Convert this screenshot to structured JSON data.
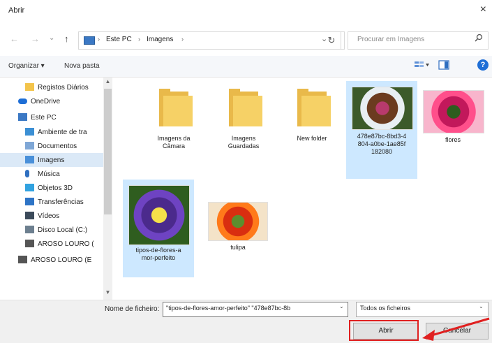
{
  "window": {
    "title": "Abrir",
    "close_glyph": "×"
  },
  "nav": {
    "back_glyph": "←",
    "forward_glyph": "→",
    "up_glyph": "↑",
    "breadcrumb": [
      "Este PC",
      "Imagens"
    ],
    "sep": "›",
    "dropdown_glyph": "⌄",
    "refresh_glyph": "↻",
    "search_placeholder": "Procurar em Imagens",
    "search_icon": "search-icon"
  },
  "toolbar": {
    "organize": "Organizar ▾",
    "new_folder": "Nova pasta"
  },
  "sidebar": {
    "items": [
      {
        "label": "Registos Diários",
        "icon": "folder-icon",
        "color": "#f3c44b"
      },
      {
        "label": "OneDrive",
        "icon": "cloud-icon",
        "color": "#1e6ed6"
      },
      {
        "label": "Este PC",
        "icon": "computer-icon",
        "color": "#3b78c4"
      },
      {
        "label": "Ambiente de tra",
        "icon": "desktop-icon",
        "color": "#3b8fd4"
      },
      {
        "label": "Documentos",
        "icon": "documents-icon",
        "color": "#7fa7d6"
      },
      {
        "label": "Imagens",
        "icon": "pictures-icon",
        "color": "#4a90d9",
        "selected": true
      },
      {
        "label": "Música",
        "icon": "music-icon",
        "color": "#2f6fc0"
      },
      {
        "label": "Objetos 3D",
        "icon": "cube-icon",
        "color": "#31a2e0"
      },
      {
        "label": "Transferências",
        "icon": "download-icon",
        "color": "#2d74c6"
      },
      {
        "label": "Vídeos",
        "icon": "video-icon",
        "color": "#3b4a5a"
      },
      {
        "label": "Disco Local (C:)",
        "icon": "drive-icon",
        "color": "#6d7f8f"
      },
      {
        "label": "AROSO LOURO (",
        "icon": "drive-icon",
        "color": "#555555"
      },
      {
        "label": "AROSO LOURO (E",
        "icon": "drive-icon",
        "color": "#555555"
      }
    ],
    "scroll_up": "▲",
    "scroll_down": "▼"
  },
  "files": [
    {
      "type": "folder",
      "label": "Imagens da Câmara"
    },
    {
      "type": "folder",
      "label": "Imagens Guardadas"
    },
    {
      "type": "folder",
      "label": "New folder"
    },
    {
      "type": "image",
      "label": "478e87bc-8bd3-4804-a0be-1ae85f182080",
      "selected": true,
      "palette": [
        "#6b3b1f",
        "#e8eef2",
        "#b83a6c",
        "#3c5a2a"
      ]
    },
    {
      "type": "image",
      "label": "flores",
      "palette": [
        "#c2185b",
        "#ff4f8b",
        "#2e5d1e",
        "#f8b5cc"
      ]
    },
    {
      "type": "image",
      "label": "tipos-de-flores-amor-perfeito",
      "selected": true,
      "palette": [
        "#4b2a8c",
        "#6e43c2",
        "#f5e04a",
        "#2f5d1f"
      ]
    },
    {
      "type": "image",
      "label": "tulipa",
      "palette": [
        "#d92e10",
        "#ff7a1a",
        "#5c8e2e",
        "#f4e3c8"
      ]
    }
  ],
  "bottom": {
    "filename_label": "Nome de ficheiro:",
    "filename_value": "\"tipos-de-flores-amor-perfeito\" \"478e87bc-8b",
    "filetype_value": "Todos os ficheiros",
    "open_label": "Abrir",
    "cancel_label": "Cancelar",
    "highlight_color": "#e02020"
  }
}
